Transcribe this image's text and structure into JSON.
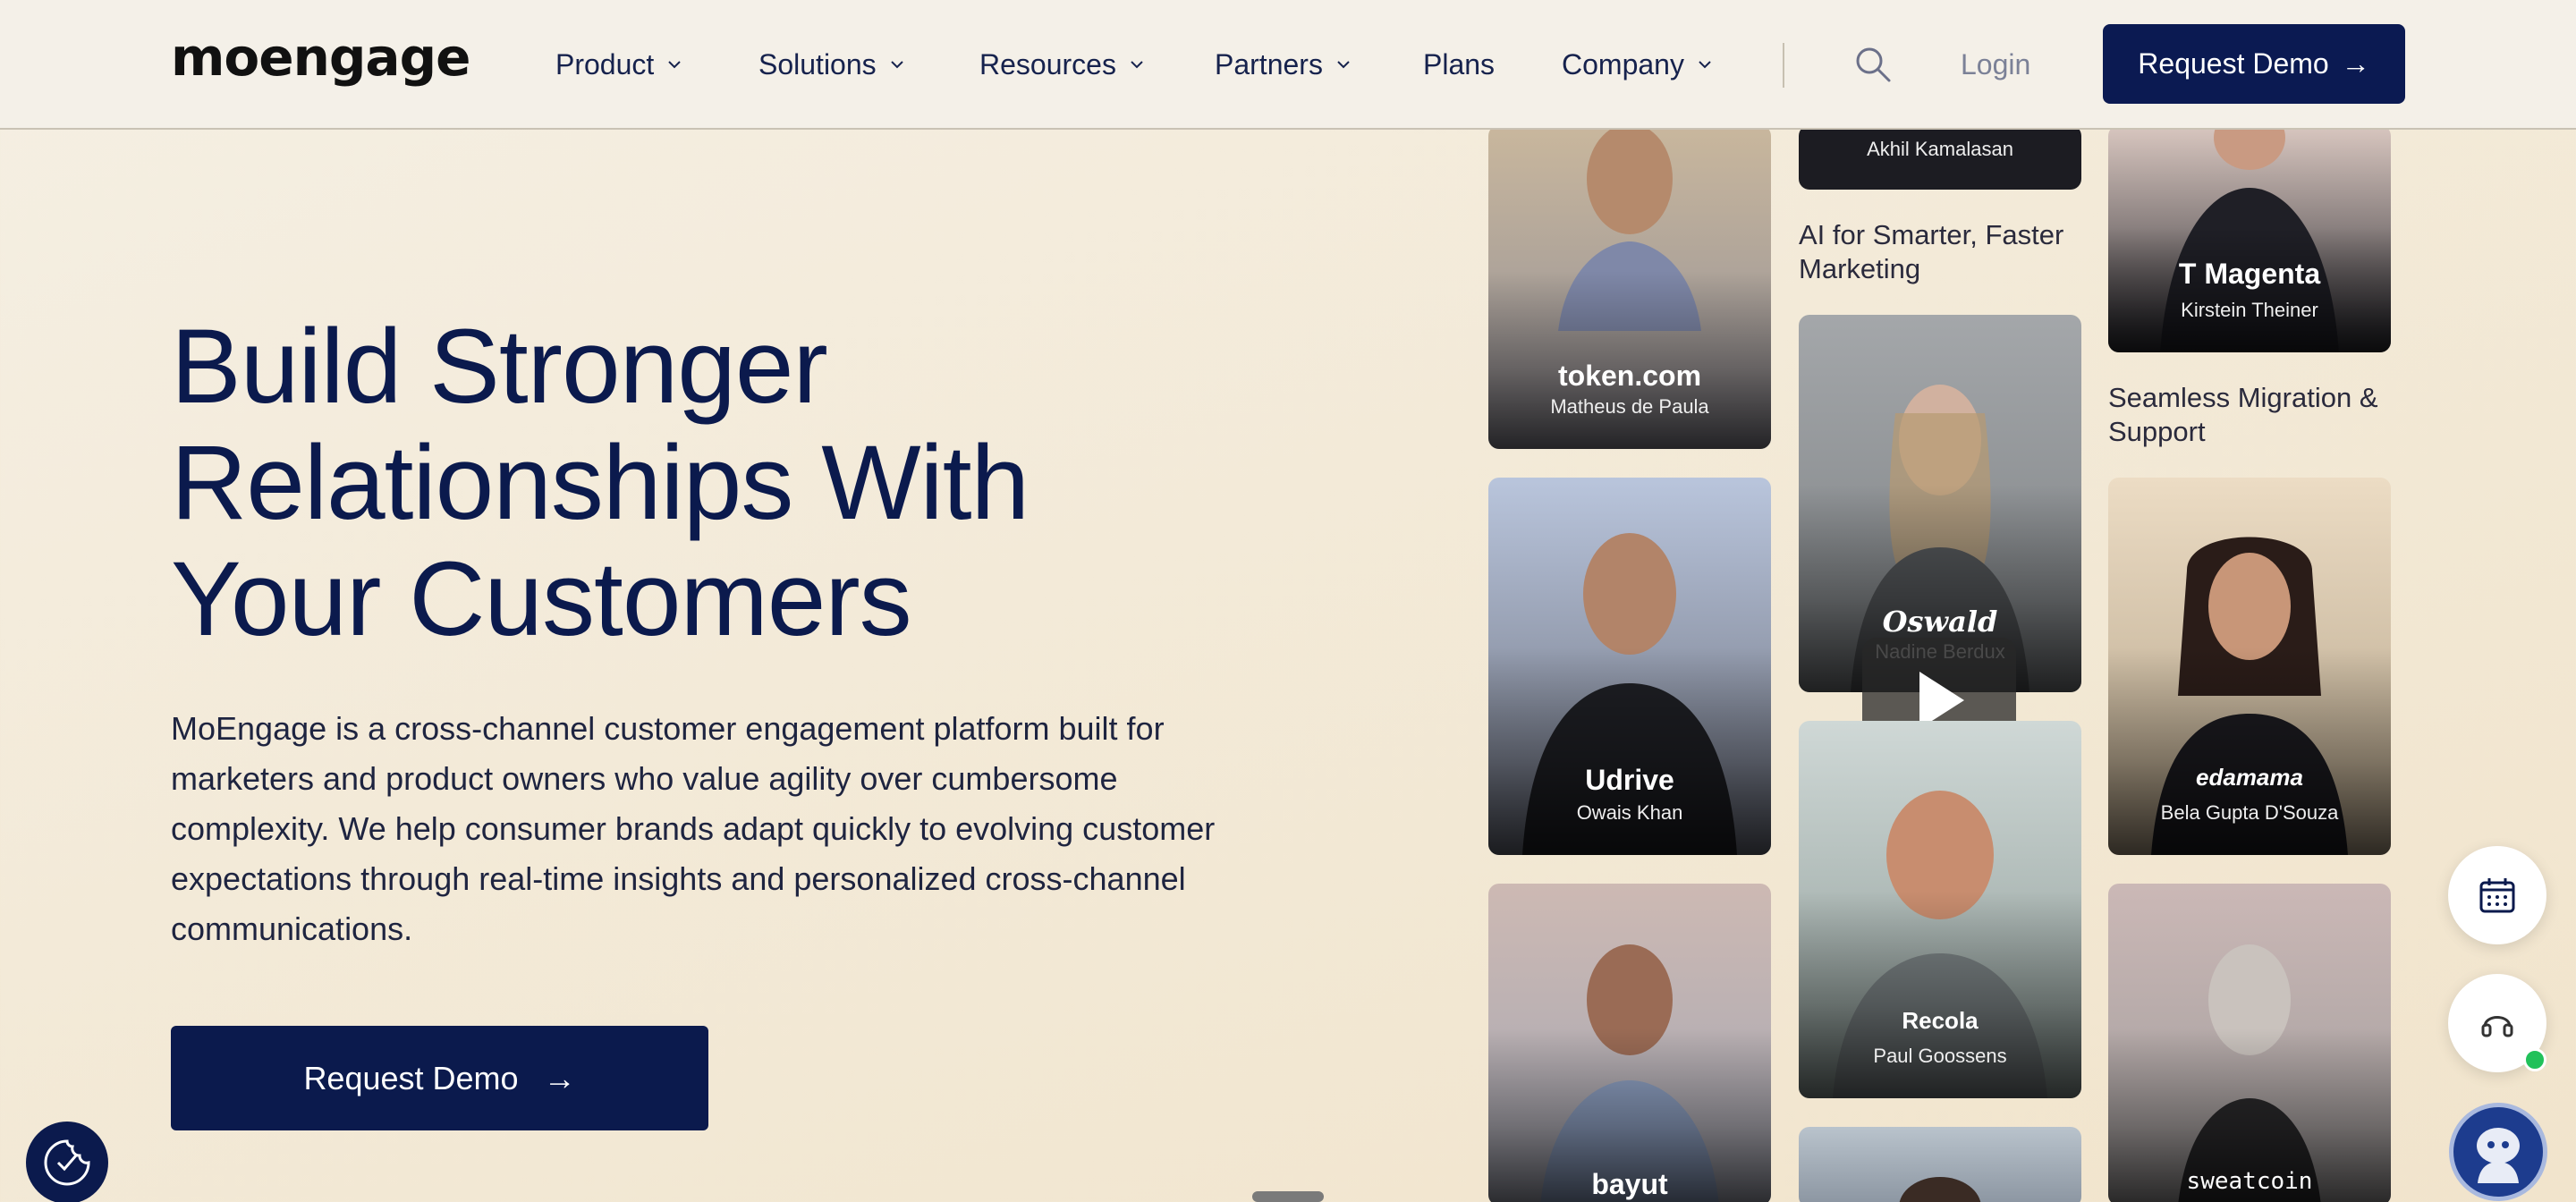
{
  "brand": {
    "logo_text": "moengage",
    "accent": "#0b1a4d"
  },
  "nav": {
    "items": [
      {
        "label": "Product",
        "has_dropdown": true
      },
      {
        "label": "Solutions",
        "has_dropdown": true
      },
      {
        "label": "Resources",
        "has_dropdown": true
      },
      {
        "label": "Partners",
        "has_dropdown": true
      },
      {
        "label": "Plans",
        "has_dropdown": false
      },
      {
        "label": "Company",
        "has_dropdown": true
      }
    ],
    "search_icon": "search-icon",
    "login_label": "Login",
    "cta_label": "Request Demo",
    "cta_arrow": "→"
  },
  "hero": {
    "title_lines": [
      "Build Stronger",
      "Relationships With",
      "Your Customers"
    ],
    "description": "MoEngage is a cross-channel customer engagement platform built for marketers and product owners who value agility over cumbersome complexity. We help consumer brands adapt quickly to evolving customer expectations through real-time insights and personalized cross-channel communications.",
    "cta_label": "Request Demo",
    "cta_arrow": "→"
  },
  "testimonials": {
    "col1": [
      {
        "brand": "token.com",
        "person": "Matheus de Paula"
      },
      {
        "brand": "Udrive",
        "person": "Owais Khan"
      },
      {
        "brand": "bayut",
        "person": ""
      }
    ],
    "col2": [
      {
        "brand": "",
        "person": "Akhil Kamalasan"
      },
      {
        "brand": "Oswald",
        "person": "Nadine Berdux"
      },
      {
        "brand": "Recola",
        "person": "Paul Goossens"
      }
    ],
    "col3": [
      {
        "brand": "T Magenta",
        "person": "Kirstein Theiner"
      },
      {
        "brand": "edamama",
        "person": "Bela Gupta D'Souza"
      },
      {
        "brand": "sweatcoin",
        "person": ""
      }
    ],
    "captions": {
      "col2": "AI for Smarter, Faster Marketing",
      "col3": "Seamless Migration & Support"
    }
  },
  "floating": {
    "calendar_icon": "calendar-icon",
    "support_icon": "headset-icon",
    "bot_icon": "chatbot-icon",
    "cookie_icon": "cookie-settings-icon"
  }
}
